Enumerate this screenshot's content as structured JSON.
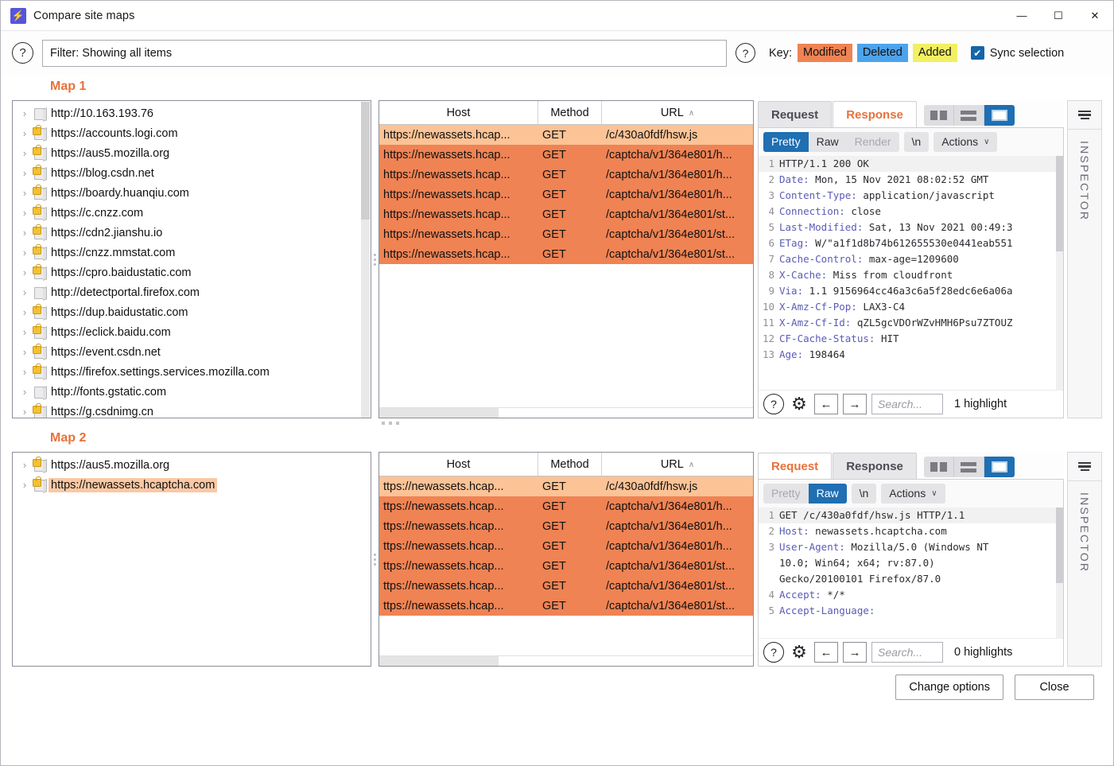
{
  "window": {
    "title": "Compare site maps",
    "logo_glyph": "⚡",
    "minimize": "—",
    "maximize": "☐",
    "close": "✕"
  },
  "filter_bar": {
    "help_glyph": "?",
    "filter_value": "Filter: Showing all items",
    "key_label": "Key:",
    "chips": [
      {
        "label": "Modified",
        "color": "#ef8354"
      },
      {
        "label": "Deleted",
        "color": "#4da3eb"
      },
      {
        "label": "Added",
        "color": "#f2f062"
      }
    ],
    "sync_label": "Sync selection",
    "sync_checked": true,
    "check_glyph": "✔"
  },
  "map1": {
    "title": "Map 1",
    "tree": [
      {
        "label": "http://10.163.193.76",
        "secure": false,
        "highlight": false
      },
      {
        "label": "https://accounts.logi.com",
        "secure": true,
        "highlight": false
      },
      {
        "label": "https://aus5.mozilla.org",
        "secure": true,
        "highlight": false
      },
      {
        "label": "https://blog.csdn.net",
        "secure": true,
        "highlight": false
      },
      {
        "label": "https://boardy.huanqiu.com",
        "secure": true,
        "highlight": false
      },
      {
        "label": "https://c.cnzz.com",
        "secure": true,
        "highlight": false
      },
      {
        "label": "https://cdn2.jianshu.io",
        "secure": true,
        "highlight": false
      },
      {
        "label": "https://cnzz.mmstat.com",
        "secure": true,
        "highlight": false
      },
      {
        "label": "https://cpro.baidustatic.com",
        "secure": true,
        "highlight": false
      },
      {
        "label": "http://detectportal.firefox.com",
        "secure": false,
        "highlight": false
      },
      {
        "label": "https://dup.baidustatic.com",
        "secure": true,
        "highlight": false
      },
      {
        "label": "https://eclick.baidu.com",
        "secure": true,
        "highlight": false
      },
      {
        "label": "https://event.csdn.net",
        "secure": true,
        "highlight": false
      },
      {
        "label": "https://firefox.settings.services.mozilla.com",
        "secure": true,
        "highlight": false
      },
      {
        "label": "http://fonts.gstatic.com",
        "secure": false,
        "highlight": false
      },
      {
        "label": "https://g.csdnimg.cn",
        "secure": true,
        "highlight": false
      }
    ],
    "table": {
      "columns": [
        "Host",
        "Method",
        "URL"
      ],
      "sort_column": "URL",
      "sort_caret": "∧",
      "rows": [
        {
          "host": "https://newassets.hcap...",
          "method": "GET",
          "url": "/c/430a0fdf/hsw.js",
          "state": "selected"
        },
        {
          "host": "https://newassets.hcap...",
          "method": "GET",
          "url": "/captcha/v1/364e801/h...",
          "state": "modified"
        },
        {
          "host": "https://newassets.hcap...",
          "method": "GET",
          "url": "/captcha/v1/364e801/h...",
          "state": "modified"
        },
        {
          "host": "https://newassets.hcap...",
          "method": "GET",
          "url": "/captcha/v1/364e801/h...",
          "state": "modified"
        },
        {
          "host": "https://newassets.hcap...",
          "method": "GET",
          "url": "/captcha/v1/364e801/st...",
          "state": "modified"
        },
        {
          "host": "https://newassets.hcap...",
          "method": "GET",
          "url": "/captcha/v1/364e801/st...",
          "state": "modified"
        },
        {
          "host": "https://newassets.hcap...",
          "method": "GET",
          "url": "/captcha/v1/364e801/st...",
          "state": "modified"
        }
      ]
    },
    "editor": {
      "tabs": [
        {
          "label": "Request",
          "active": false
        },
        {
          "label": "Response",
          "active": true
        }
      ],
      "layout_modes": [
        "side-by-side-icon",
        "stacked-icon",
        "single-icon"
      ],
      "layout_active": 2,
      "toolbar": {
        "segments": [
          {
            "label": "Pretty",
            "state": "on"
          },
          {
            "label": "Raw",
            "state": "normal"
          },
          {
            "label": "Render",
            "state": "off"
          }
        ],
        "newline": "\\n",
        "actions": "Actions",
        "caret": "∨"
      },
      "lines": [
        {
          "n": "1",
          "name": "",
          "text": "HTTP/1.1 200 OK"
        },
        {
          "n": "2",
          "name": "Date:",
          "text": " Mon, 15 Nov 2021 08:02:52 GMT"
        },
        {
          "n": "3",
          "name": "Content-Type:",
          "text": " application/javascript"
        },
        {
          "n": "4",
          "name": "Connection:",
          "text": " close"
        },
        {
          "n": "5",
          "name": "Last-Modified:",
          "text": " Sat, 13 Nov 2021 00:49:3"
        },
        {
          "n": "6",
          "name": "ETag:",
          "text": " W/\"a1f1d8b74b612655530e0441eab551"
        },
        {
          "n": "7",
          "name": "Cache-Control:",
          "text": " max-age=1209600"
        },
        {
          "n": "8",
          "name": "X-Cache:",
          "text": " Miss from cloudfront"
        },
        {
          "n": "9",
          "name": "Via:",
          "text": " 1.1 9156964cc46a3c6a5f28edc6e6a06a"
        },
        {
          "n": "10",
          "name": "X-Amz-Cf-Pop:",
          "text": " LAX3-C4"
        },
        {
          "n": "11",
          "name": "X-Amz-Cf-Id:",
          "text": " qZL5gcVDOrWZvHMH6Psu7ZTOUZ"
        },
        {
          "n": "12",
          "name": "CF-Cache-Status:",
          "text": " HIT"
        },
        {
          "n": "13",
          "name": "Age:",
          "text": " 198464"
        }
      ],
      "footer": {
        "help_glyph": "?",
        "gear_glyph": "⚙",
        "prev_glyph": "←",
        "next_glyph": "→",
        "search_placeholder": "Search...",
        "highlight_count": "1 highlight"
      }
    },
    "inspector_label": "INSPECTOR"
  },
  "map2": {
    "title": "Map 2",
    "tree": [
      {
        "label": "https://aus5.mozilla.org",
        "secure": true,
        "highlight": false
      },
      {
        "label": "https://newassets.hcaptcha.com",
        "secure": true,
        "highlight": true
      }
    ],
    "table": {
      "columns": [
        "Host",
        "Method",
        "URL"
      ],
      "sort_column": "URL",
      "sort_caret": "∧",
      "rows": [
        {
          "host": "ttps://newassets.hcap...",
          "method": "GET",
          "url": "/c/430a0fdf/hsw.js",
          "state": "selected"
        },
        {
          "host": "ttps://newassets.hcap...",
          "method": "GET",
          "url": "/captcha/v1/364e801/h...",
          "state": "modified"
        },
        {
          "host": "ttps://newassets.hcap...",
          "method": "GET",
          "url": "/captcha/v1/364e801/h...",
          "state": "modified"
        },
        {
          "host": "ttps://newassets.hcap...",
          "method": "GET",
          "url": "/captcha/v1/364e801/h...",
          "state": "modified"
        },
        {
          "host": "ttps://newassets.hcap...",
          "method": "GET",
          "url": "/captcha/v1/364e801/st...",
          "state": "modified"
        },
        {
          "host": "ttps://newassets.hcap...",
          "method": "GET",
          "url": "/captcha/v1/364e801/st...",
          "state": "modified"
        },
        {
          "host": "ttps://newassets.hcap...",
          "method": "GET",
          "url": "/captcha/v1/364e801/st...",
          "state": "modified"
        }
      ]
    },
    "editor": {
      "tabs": [
        {
          "label": "Request",
          "active": true
        },
        {
          "label": "Response",
          "active": false
        }
      ],
      "layout_active": 2,
      "toolbar": {
        "segments": [
          {
            "label": "Pretty",
            "state": "off"
          },
          {
            "label": "Raw",
            "state": "on"
          }
        ],
        "newline": "\\n",
        "actions": "Actions",
        "caret": "∨"
      },
      "lines": [
        {
          "n": "1",
          "name": "",
          "text": "GET /c/430a0fdf/hsw.js HTTP/1.1"
        },
        {
          "n": "2",
          "name": "Host:",
          "text": " newassets.hcaptcha.com"
        },
        {
          "n": "3",
          "name": "User-Agent:",
          "text": " Mozilla/5.0 (Windows NT"
        },
        {
          "n": "",
          "name": "",
          "text": "10.0; Win64; x64; rv:87.0)"
        },
        {
          "n": "",
          "name": "",
          "text": "Gecko/20100101 Firefox/87.0"
        },
        {
          "n": "4",
          "name": "Accept:",
          "text": " */*"
        },
        {
          "n": "5",
          "name": "Accept-Language:",
          "text": ""
        }
      ],
      "footer": {
        "help_glyph": "?",
        "gear_glyph": "⚙",
        "prev_glyph": "←",
        "next_glyph": "→",
        "search_placeholder": "Search...",
        "highlight_count": "0 highlights"
      }
    },
    "inspector_label": "INSPECTOR"
  },
  "footer": {
    "change_options": "Change options",
    "close": "Close"
  }
}
